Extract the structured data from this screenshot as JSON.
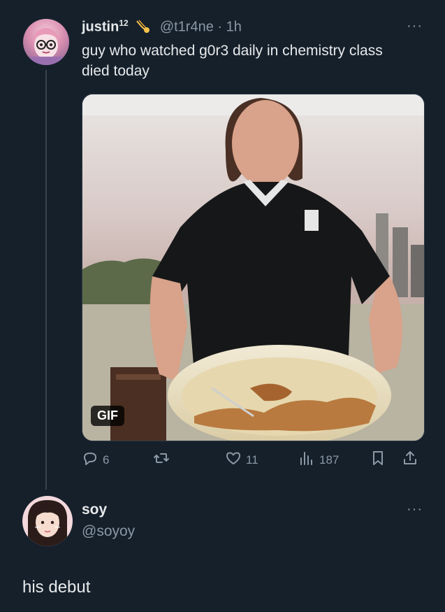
{
  "tweet": {
    "display_name": "justin",
    "name_sup": "12",
    "badge_icon": "comet-icon",
    "handle": "@t1r4ne",
    "time": " · 1h",
    "more": "···",
    "text": "guy who watched g0r3 daily in chemistry class died today",
    "media": {
      "type": "gif",
      "badge": "GIF"
    },
    "actions": {
      "reply": {
        "icon": "reply-icon",
        "count": "6"
      },
      "retweet": {
        "icon": "retweet-icon",
        "count": ""
      },
      "like": {
        "icon": "heart-icon",
        "count": "11"
      },
      "views": {
        "icon": "views-icon",
        "count": "187"
      },
      "bookmark": {
        "icon": "bookmark-icon"
      },
      "share": {
        "icon": "share-icon"
      }
    }
  },
  "reply_tweet": {
    "display_name": "soy",
    "handle": "@soyoy",
    "more": "···",
    "text": "his debut"
  },
  "colors": {
    "background": "#15202b",
    "text_primary": "#e7e9ea",
    "text_secondary": "#8b98a5",
    "thread_line": "#38444d"
  }
}
